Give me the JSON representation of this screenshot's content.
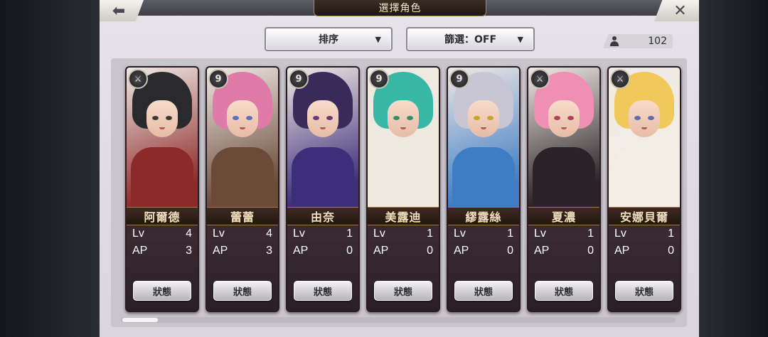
{
  "header": {
    "title": "選擇角色",
    "back_icon": "back-arrow-icon",
    "close_icon": "close-x-icon"
  },
  "controls": {
    "sort_label": "排序",
    "filter_label": "篩選：OFF",
    "dropdown_arrow": "▼",
    "roster_count": "102"
  },
  "cards": [
    {
      "name": "阿爾德",
      "badge": "⚔",
      "badge_type": "sword",
      "lv_label": "Lv",
      "lv": "4",
      "ap_label": "AP",
      "ap": "3",
      "status_label": "狀態",
      "hair": "#2a2a2e",
      "eyes": "#3b3b3b",
      "outfit": "#8c2a2a"
    },
    {
      "name": "蕾蕾",
      "badge": "9",
      "badge_type": "number",
      "lv_label": "Lv",
      "lv": "4",
      "ap_label": "AP",
      "ap": "3",
      "status_label": "狀態",
      "hair": "#e07aa8",
      "eyes": "#5b6fbf",
      "outfit": "#6b4a3a"
    },
    {
      "name": "由奈",
      "badge": "9",
      "badge_type": "number",
      "lv_label": "Lv",
      "lv": "1",
      "ap_label": "AP",
      "ap": "0",
      "status_label": "狀態",
      "hair": "#3a2a5a",
      "eyes": "#6a3a7a",
      "outfit": "#3d2e7a"
    },
    {
      "name": "美露迪",
      "badge": "9",
      "badge_type": "number",
      "lv_label": "Lv",
      "lv": "1",
      "ap_label": "AP",
      "ap": "0",
      "status_label": "狀態",
      "hair": "#39b7a6",
      "eyes": "#2f8f6f",
      "outfit": "#efe8dc"
    },
    {
      "name": "繆露絲",
      "badge": "9",
      "badge_type": "number",
      "lv_label": "Lv",
      "lv": "1",
      "ap_label": "AP",
      "ap": "0",
      "status_label": "狀態",
      "hair": "#c8c6d4",
      "eyes": "#c9a22a",
      "outfit": "#3e7cc4"
    },
    {
      "name": "夏濃",
      "badge": "⚔",
      "badge_type": "sword",
      "lv_label": "Lv",
      "lv": "1",
      "ap_label": "AP",
      "ap": "0",
      "status_label": "狀態",
      "hair": "#f08fb4",
      "eyes": "#b04060",
      "outfit": "#2a2226"
    },
    {
      "name": "安娜貝爾",
      "badge": "⚔",
      "badge_type": "sword",
      "lv_label": "Lv",
      "lv": "1",
      "ap_label": "AP",
      "ap": "0",
      "status_label": "狀態",
      "hair": "#f1c85a",
      "eyes": "#5a6fb0",
      "outfit": "#f3eee6"
    }
  ]
}
